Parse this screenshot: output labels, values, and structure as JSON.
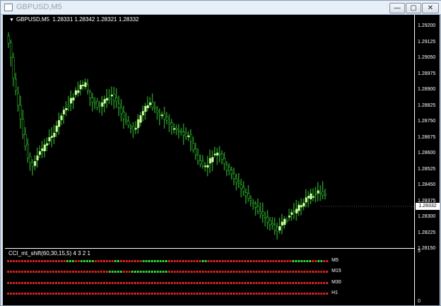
{
  "window": {
    "title": "GBPUSD,M5",
    "buttons": {
      "minimize": "—",
      "maximize": "▢",
      "close": "✕"
    }
  },
  "chart": {
    "info_arrow": "▼",
    "symbol": "GBPUSD,M5",
    "ohlc": "1.28331 1.28342 1.28321 1.28332",
    "current_price": "1.28332",
    "bull_color": "#ccff99",
    "bear_color": "#000000",
    "wick_color": "#33cc33"
  },
  "price_axis": [
    "1.29200",
    "1.29125",
    "1.29050",
    "1.28975",
    "1.28900",
    "1.28825",
    "1.28750",
    "1.28675",
    "1.28600",
    "1.28525",
    "1.28450",
    "1.28375",
    "1.28300",
    "1.28225",
    "1.28150"
  ],
  "indicator": {
    "name": "CCI_mt_shift(60,30,15,5) 4 3 2 1",
    "scale_top": "5",
    "scale_bottom": "0",
    "colors": {
      "up": "#33cc33",
      "down": "#cc2222"
    },
    "rows": [
      {
        "label": "M5",
        "green_segments": [
          [
            0.185,
            0.205
          ],
          [
            0.225,
            0.265
          ],
          [
            0.33,
            0.35
          ],
          [
            0.42,
            0.495
          ],
          [
            0.605,
            0.625
          ],
          [
            0.885,
            0.945
          ],
          [
            0.965,
            0.985
          ]
        ]
      },
      {
        "label": "M15",
        "green_segments": [
          [
            0.31,
            0.36
          ],
          [
            0.385,
            0.495
          ]
        ]
      },
      {
        "label": "M30",
        "green_segments": []
      },
      {
        "label": "H1",
        "green_segments": []
      }
    ]
  }
}
